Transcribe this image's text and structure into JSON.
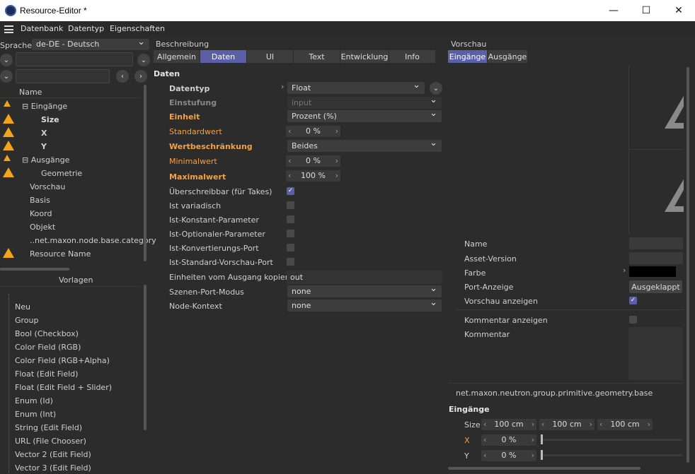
{
  "window": {
    "title": "Resource-Editor *",
    "minimize": "—",
    "maximize": "☐",
    "close": "✕"
  },
  "menu": [
    "Datenbank",
    "Datentyp",
    "Eigenschaften"
  ],
  "left": {
    "language_label": "Sprache",
    "language_value": "de-DE - Deutsch",
    "name_header": "Name",
    "tree": [
      {
        "label": "⊟ Eingänge",
        "warn": true
      },
      {
        "label": "Size",
        "warn": true
      },
      {
        "label": "X",
        "warn": true
      },
      {
        "label": "Y",
        "warn": false
      },
      {
        "label": "⊟ Ausgänge",
        "warn": true
      },
      {
        "label": "Geometrie",
        "warn": true
      },
      {
        "label": "Vorschau",
        "warn": false
      },
      {
        "label": "Basis",
        "warn": false
      },
      {
        "label": "Koord",
        "warn": false
      },
      {
        "label": "Objekt",
        "warn": false
      },
      {
        "label": "..net.maxon.node.base.category",
        "warn": false
      },
      {
        "label": "Resource Name",
        "warn": true
      }
    ],
    "templates_header": "Vorlagen",
    "templates": [
      "Neu",
      "Group",
      "Bool (Checkbox)",
      "Color Field (RGB)",
      "Color Field (RGB+Alpha)",
      "Float (Edit Field)",
      "Float (Edit Field + Slider)",
      "Enum (Id)",
      "Enum (Int)",
      "String (Edit Field)",
      "URL (File Chooser)",
      "Vector 2 (Edit Field)",
      "Vector 3 (Edit Field)"
    ]
  },
  "middle": {
    "section": "Beschreibung",
    "tabs": [
      "Allgemein",
      "Daten",
      "UI",
      "Text",
      "Entwicklung",
      "Info"
    ],
    "active_tab": "Daten",
    "heading": "Daten",
    "datentyp_label": "Datentyp",
    "datentyp_value": "Float",
    "einstufung_label": "Einstufung",
    "einstufung_value": "input",
    "einheit_label": "Einheit",
    "einheit_value": "Prozent (%)",
    "standardwert_label": "Standardwert",
    "standardwert_value": "0 %",
    "wertbeschraenkung_label": "Wertbeschränkung",
    "wertbeschraenkung_value": "Beides",
    "minimalwert_label": "Minimalwert",
    "minimalwert_value": "0 %",
    "maximalwert_label": "Maximalwert",
    "maximalwert_value": "100 %",
    "checks": [
      {
        "label": "Überschreibbar (für Takes)",
        "checked": true
      },
      {
        "label": "Ist variadisch",
        "checked": false
      },
      {
        "label": "Ist-Konstant-Parameter",
        "checked": false
      },
      {
        "label": "Ist-Optionaler-Parameter",
        "checked": false
      },
      {
        "label": "Ist-Konvertierungs-Port",
        "checked": false
      },
      {
        "label": "Ist-Standard-Vorschau-Port",
        "checked": false
      }
    ],
    "einheiten_label": "Einheiten vom Ausgang kopieren",
    "einheiten_value": "out",
    "szenen_label": "Szenen-Port-Modus",
    "szenen_value": "none",
    "node_label": "Node-Kontext",
    "node_value": "none"
  },
  "right": {
    "section": "Vorschau",
    "tabs": [
      "Eingänge",
      "Ausgänge"
    ],
    "props": [
      "Name",
      "Asset-Version",
      "Farbe",
      "Port-Anzeige",
      "Vorschau anzeigen"
    ],
    "port_anzeige_value": "Ausgeklappt",
    "kommentar_anzeigen": "Kommentar anzeigen",
    "kommentar": "Kommentar",
    "asset_id": "net.maxon.neutron.group.primitive.geometry.base",
    "eingaenge_heading": "Eingänge",
    "size_label": "Size",
    "size_values": [
      "100 cm",
      "100 cm",
      "100 cm"
    ],
    "x_label": "X",
    "x_value": "0 %",
    "y_label": "Y",
    "y_value": "0 %"
  }
}
